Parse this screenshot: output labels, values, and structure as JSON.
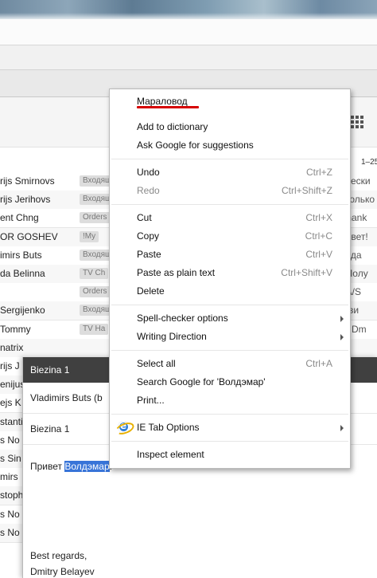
{
  "browser": {
    "page_count": "1–25"
  },
  "inbox": {
    "rows": [
      {
        "sender": "rijs Smirnovs",
        "label": "Входящие",
        "snippet": "ически"
      },
      {
        "sender": "rijs Jerihovs",
        "label": "Входящие",
        "snippet": "сколько"
      },
      {
        "sender": "ent Chng",
        "label": "Orders",
        "snippet": "Thank"
      },
      {
        "sender": "OR GOSHEV",
        "label": "!My",
        "snippet": "ривет!"
      },
      {
        "sender": "imirs Buts",
        "label": "Входящие",
        "snippet": "пода"
      },
      {
        "sender": "da Belinna",
        "label": "TV Ch",
        "snippet": ", Полу"
      },
      {
        "sender": "",
        "label": "Orders",
        "snippet": "_A/S"
      },
      {
        "sender": "Sergijenko",
        "label": "Входящие",
        "snippet": "и ви"
      },
      {
        "sender": "Tommy",
        "label": "TV Ha",
        "snippet": "ar Dm"
      },
      {
        "sender": "natrix",
        "label": "",
        "snippet": ""
      },
      {
        "sender": "rijs J",
        "label": "",
        "snippet": ""
      },
      {
        "sender": "enijus",
        "label": "",
        "snippet": ""
      },
      {
        "sender": "ejs K",
        "label": "",
        "snippet": ""
      },
      {
        "sender": "stanti",
        "label": "",
        "snippet": ""
      },
      {
        "sender": "s No",
        "label": "",
        "snippet": ""
      },
      {
        "sender": "s Sin",
        "label": "",
        "snippet": ""
      },
      {
        "sender": "mirs",
        "label": "",
        "snippet": ""
      },
      {
        "sender": "stoph",
        "label": "",
        "snippet": ""
      },
      {
        "sender": "s No",
        "label": "",
        "snippet": ""
      },
      {
        "sender": "s No",
        "label": "",
        "snippet": ""
      }
    ]
  },
  "compose": {
    "title": "Biezina 1",
    "to": "Vladimirs Buts (b",
    "subject": "Biezina 1",
    "body_prefix": "Привет ",
    "body_selected": "Волдэмар",
    "body_suffix": ".",
    "signature_line1": "Best regards,",
    "signature_line2": "Dmitry Belayev"
  },
  "context_menu": {
    "suggestion": "Мараловод",
    "add_to_dictionary": "Add to dictionary",
    "ask_google": "Ask Google for suggestions",
    "undo": {
      "label": "Undo",
      "shortcut": "Ctrl+Z"
    },
    "redo": {
      "label": "Redo",
      "shortcut": "Ctrl+Shift+Z"
    },
    "cut": {
      "label": "Cut",
      "shortcut": "Ctrl+X"
    },
    "copy": {
      "label": "Copy",
      "shortcut": "Ctrl+C"
    },
    "paste": {
      "label": "Paste",
      "shortcut": "Ctrl+V"
    },
    "paste_plain": {
      "label": "Paste as plain text",
      "shortcut": "Ctrl+Shift+V"
    },
    "delete": "Delete",
    "spell_options": "Spell-checker options",
    "writing_direction": "Writing Direction",
    "select_all": {
      "label": "Select all",
      "shortcut": "Ctrl+A"
    },
    "search_google": "Search Google for 'Волдэмар'",
    "print": "Print...",
    "ie_tab": "IE Tab Options",
    "inspect": "Inspect element"
  },
  "colors": {
    "selection": "#3874d8",
    "compose_header": "#404040",
    "spell_underline": "#d60000"
  }
}
